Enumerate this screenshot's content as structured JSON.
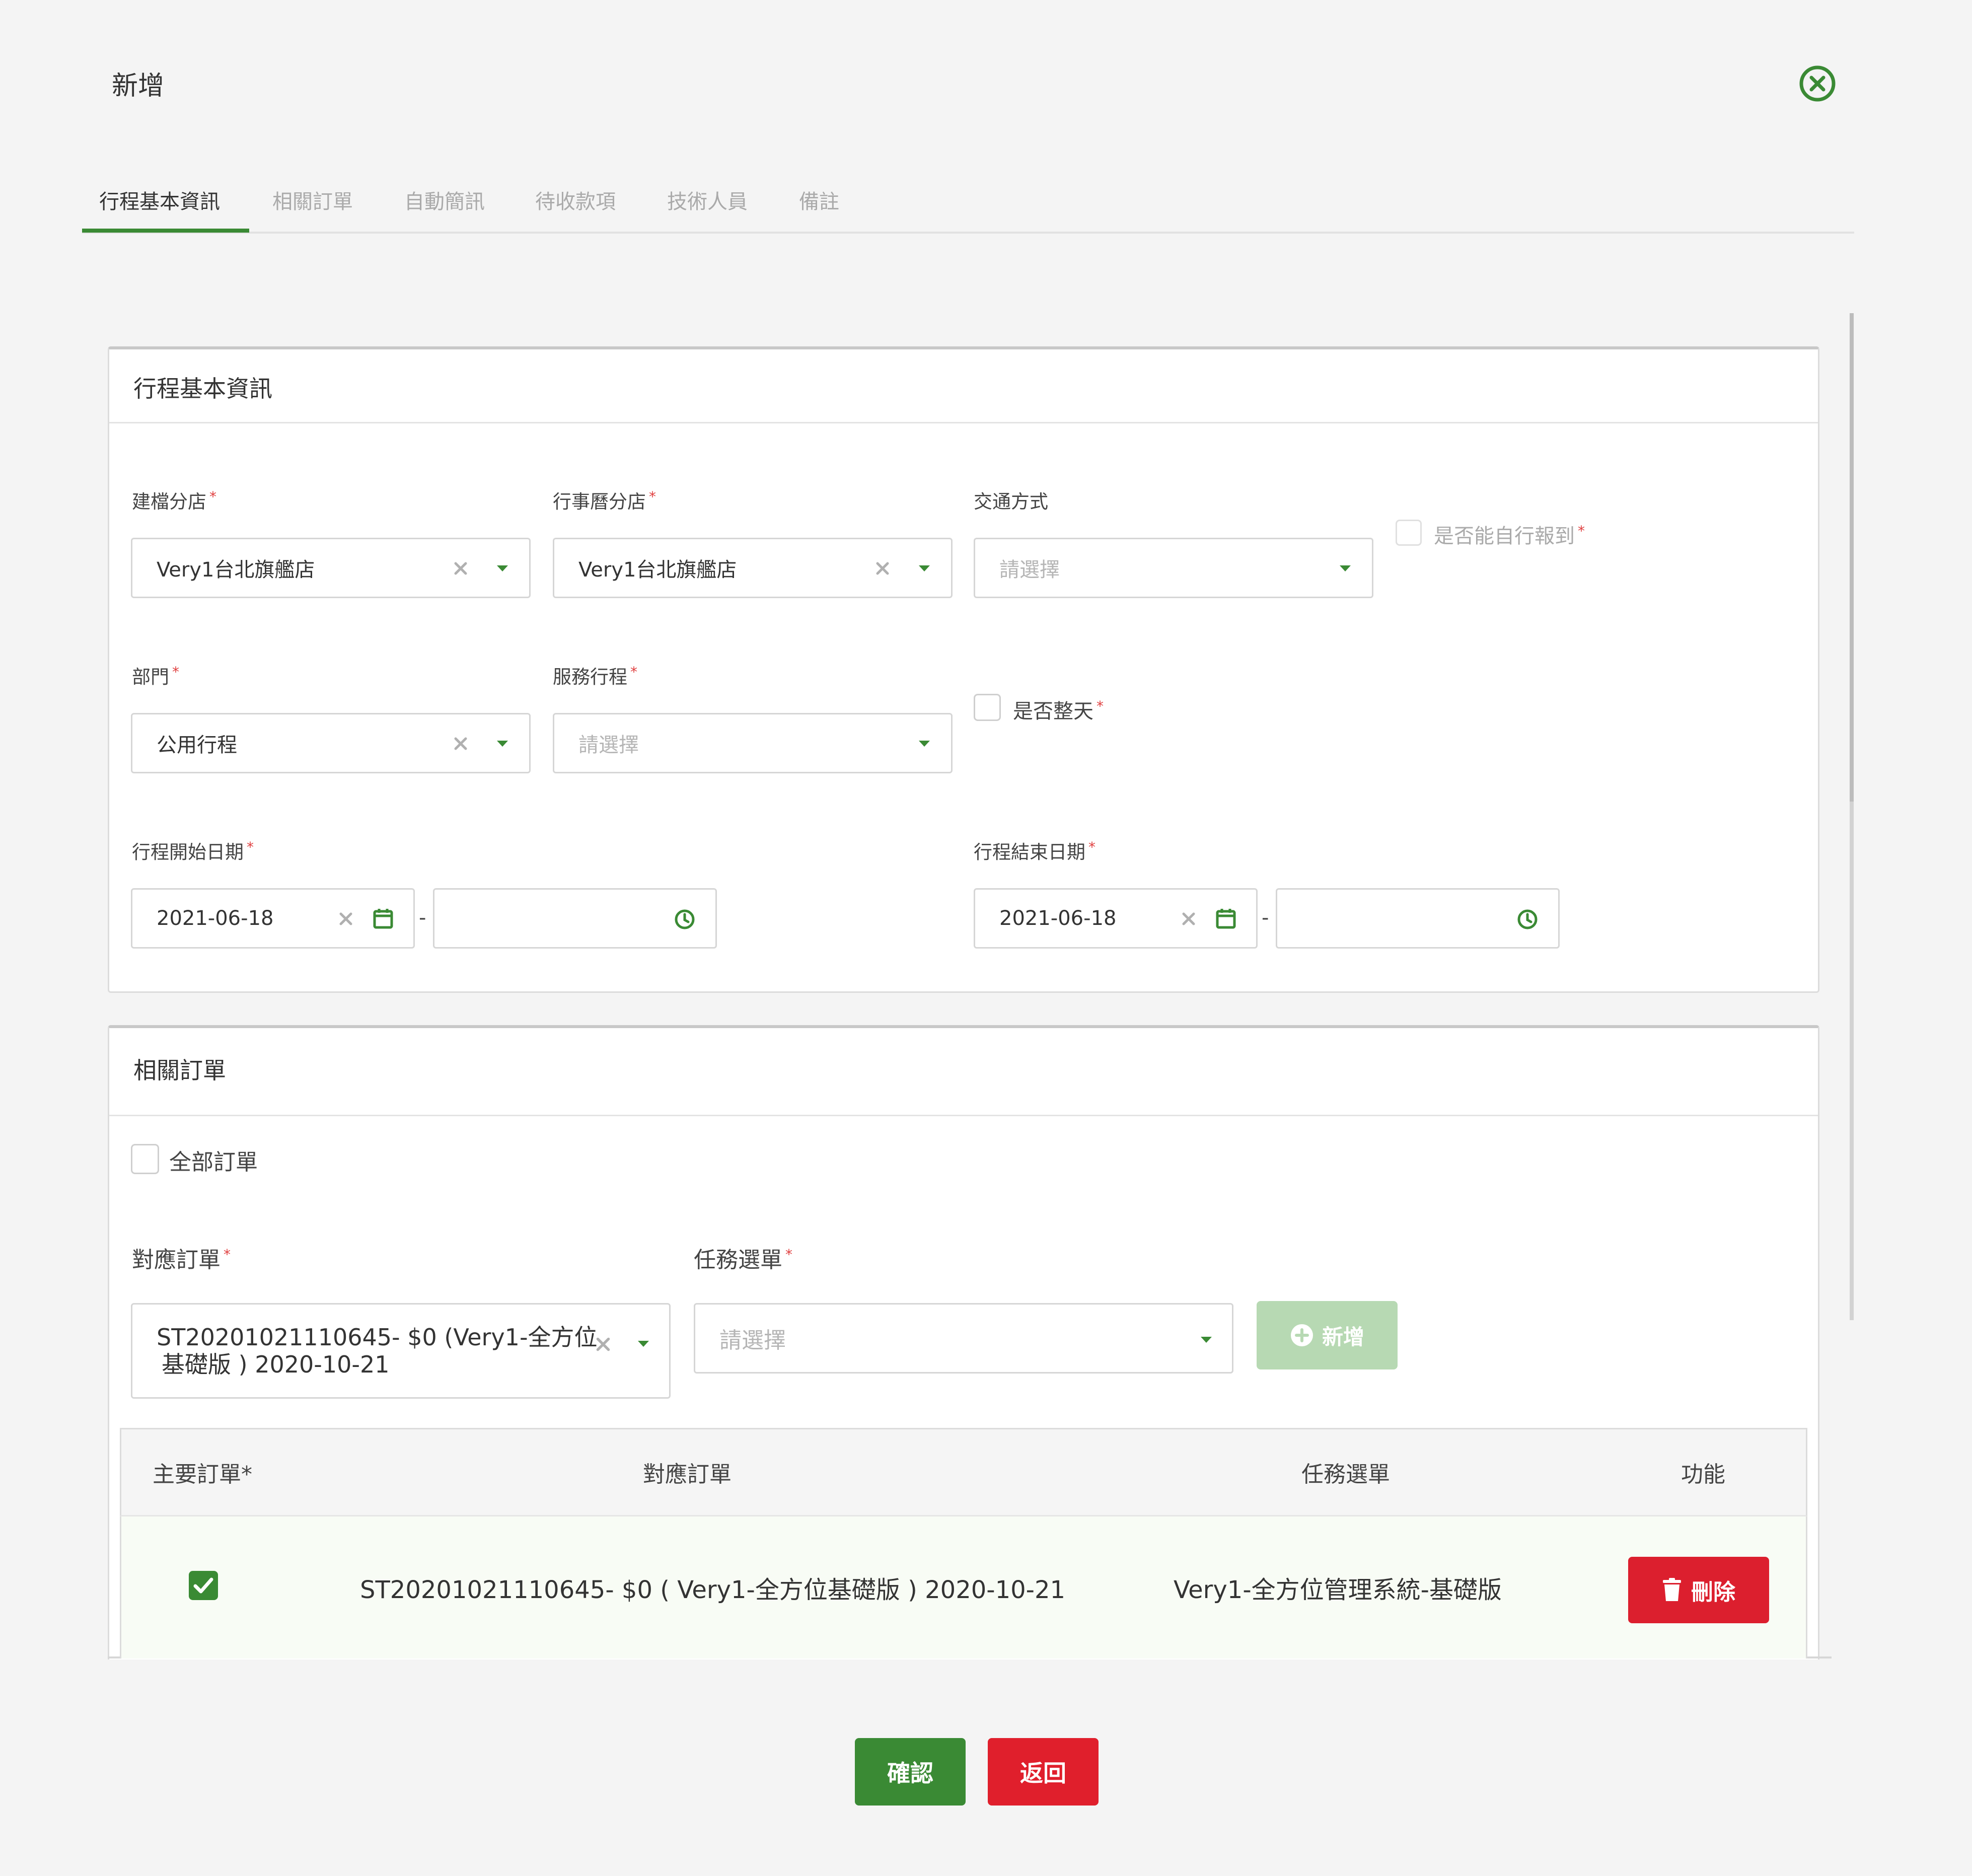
{
  "modal": {
    "title": "新增"
  },
  "tabs": [
    {
      "label": "行程基本資訊",
      "active": true
    },
    {
      "label": "相關訂單"
    },
    {
      "label": "自動簡訊"
    },
    {
      "label": "待收款項"
    },
    {
      "label": "技術人員"
    },
    {
      "label": "備註"
    }
  ],
  "basic_info": {
    "title": "行程基本資訊",
    "created_branch": {
      "label": "建檔分店",
      "value": "Very1台北旗艦店"
    },
    "calendar_branch": {
      "label": "行事曆分店",
      "value": "Very1台北旗艦店"
    },
    "transport": {
      "label": "交通方式",
      "placeholder": "請選擇"
    },
    "self_report": {
      "label": "是否能自行報到"
    },
    "department": {
      "label": "部門",
      "value": "公用行程"
    },
    "service": {
      "label": "服務行程",
      "placeholder": "請選擇"
    },
    "all_day": {
      "label": "是否整天"
    },
    "start_date": {
      "label": "行程開始日期",
      "date": "2021-06-18",
      "separator": "-"
    },
    "end_date": {
      "label": "行程結束日期",
      "date": "2021-06-18",
      "separator": "-"
    }
  },
  "orders": {
    "title": "相關訂單",
    "all_orders_label": "全部訂單",
    "order": {
      "label": "對應訂單",
      "value_line1": "ST20201021110645- $0 (Very1-全方位",
      "value_line2": "基礎版 ) 2020-10-21"
    },
    "task": {
      "label": "任務選單",
      "placeholder": "請選擇"
    },
    "add_label": "新增",
    "table": {
      "headers": [
        "主要訂單*",
        "對應訂單",
        "任務選單",
        "功能"
      ],
      "rows": [
        {
          "main": true,
          "order": "ST20201021110645- $0 ( Very1-全方位基礎版 ) 2020-10-21",
          "task": "Very1-全方位管理系統-基礎版",
          "delete_label": "刪除"
        }
      ]
    }
  },
  "footer": {
    "confirm": "確認",
    "back": "返回"
  },
  "colors": {
    "accent": "#3a8a34",
    "danger": "#dc1f2e",
    "add_disabled": "#b7d9b3",
    "required": "#e04040"
  }
}
